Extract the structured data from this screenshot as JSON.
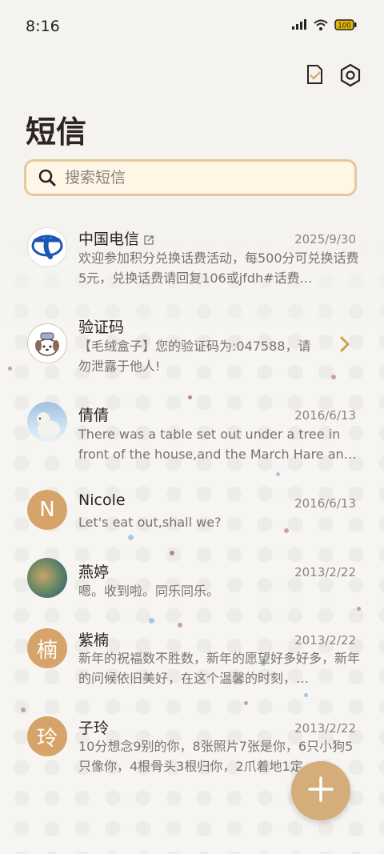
{
  "status_bar": {
    "time": "8:16",
    "battery": "100"
  },
  "header": {
    "title": "短信"
  },
  "search": {
    "placeholder": "搜索短信"
  },
  "conversations": [
    {
      "name": "中国电信",
      "date": "2025/9/30",
      "preview": "欢迎参加积分兑换话费活动，每500分可兑换话费5元，兑换话费请回复106或jfdh#话费…",
      "avatar_letter": ""
    },
    {
      "name": "验证码",
      "date": "",
      "preview": "【毛绒盒子】您的验证码为:047588，请勿泄露于他人!",
      "avatar_letter": ""
    },
    {
      "name": "倩倩",
      "date": "2016/6/13",
      "preview": "There was a table set out under a tree in front of the house,and the March Hare an…",
      "avatar_letter": ""
    },
    {
      "name": "Nicole",
      "date": "2016/6/13",
      "preview": "Let's eat out,shall we?",
      "avatar_letter": "N"
    },
    {
      "name": "燕婷",
      "date": "2013/2/22",
      "preview": "嗯。收到啦。同乐同乐。",
      "avatar_letter": ""
    },
    {
      "name": "紫楠",
      "date": "2013/2/22",
      "preview": "新年的祝福数不胜数，新年的愿望好多好多，新年的问候依旧美好，在这个温馨的时刻，…",
      "avatar_letter": "楠"
    },
    {
      "name": "子玲",
      "date": "2013/2/22",
      "preview": "10分想念9别的你，8张照片7张是你，6只小狗5只像你，4根骨头3根归你，2爪着地1定…",
      "avatar_letter": "玲"
    }
  ],
  "colors": {
    "accent": "#d4ad7a",
    "search_border": "#e5c89c",
    "search_bg": "#fff6e6",
    "avatar_bg": "#d6a46a"
  },
  "icons": [
    "signal-icon",
    "wifi-icon",
    "battery-icon",
    "edit-list-icon",
    "settings-icon",
    "search-icon",
    "china-telecom-logo",
    "chevron-right-icon",
    "add-icon"
  ]
}
